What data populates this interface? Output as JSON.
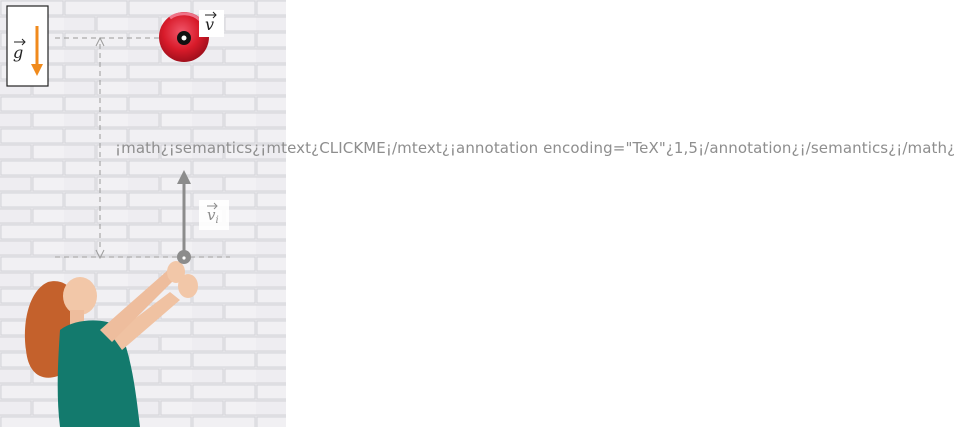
{
  "labels": {
    "gravity": "g",
    "velocity": "v",
    "initial_velocity_symbol": "v",
    "initial_velocity_subscript": "i",
    "height_markup": "¡math¿¡semantics¿¡mtext¿CLICKME¡/mtext¿¡annotation encoding=\"TeX\"¿1,5¡/annotation¿¡/semantics¿¡/math¿"
  },
  "colors": {
    "gravity_arrow": "#f08a1c",
    "velocity_arrow": "#8c8c8c",
    "ball": "#d81b2a",
    "guide_line": "#9a9a9a",
    "wall": "#e8e6ea"
  },
  "icons": {
    "ball": "red-ball-icon",
    "gravity": "down-arrow-icon",
    "velocity": "up-arrow-icon"
  }
}
